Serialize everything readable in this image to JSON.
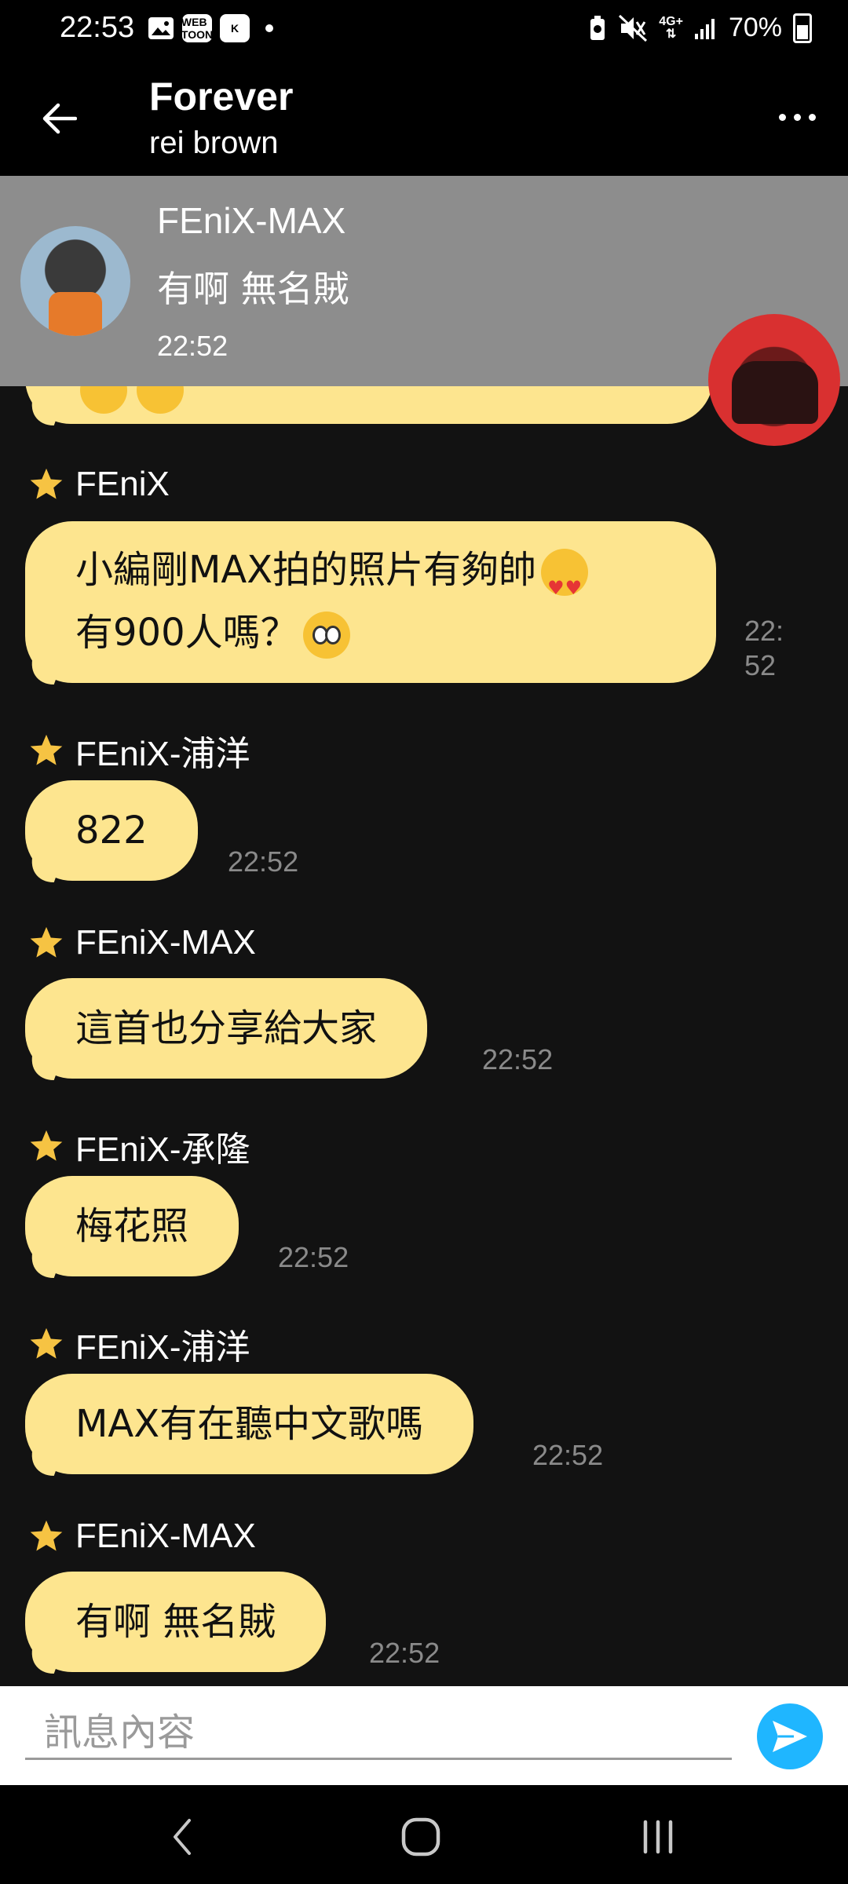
{
  "status_bar": {
    "time": "22:53",
    "left_icons": [
      "gallery-icon",
      "webtoon-icon",
      "k-icon"
    ],
    "webtoon_label": "WEB TOON",
    "k_label": "K",
    "network": "4G+",
    "battery": "70%"
  },
  "header": {
    "title": "Forever",
    "subtitle": "rei brown"
  },
  "notification": {
    "sender": "FEniX-MAX",
    "message": "有啊 無名賊",
    "time": "22:52"
  },
  "messages": [
    {
      "sender": "FEniX",
      "text_line1": "小編剛MAX拍的照片有夠帥",
      "text_line2": "有900人嗎？",
      "time_line1": "22:",
      "time_line2": "52"
    },
    {
      "sender": "FEniX-浦洋",
      "text": "822",
      "time": "22:52"
    },
    {
      "sender": "FEniX-MAX",
      "text": "這首也分享給大家",
      "time": "22:52"
    },
    {
      "sender": "FEniX-承隆",
      "text": "梅花照",
      "time": "22:52"
    },
    {
      "sender": "FEniX-浦洋",
      "text": "MAX有在聽中文歌嗎",
      "time": "22:52"
    },
    {
      "sender": "FEniX-MAX",
      "text": "有啊 無名賊",
      "time": "22:52"
    }
  ],
  "input": {
    "placeholder": "訊息內容"
  },
  "colors": {
    "bubble": "#fde58f",
    "background": "#121212",
    "send_button": "#1fb6ff",
    "star": "#f6c343"
  }
}
